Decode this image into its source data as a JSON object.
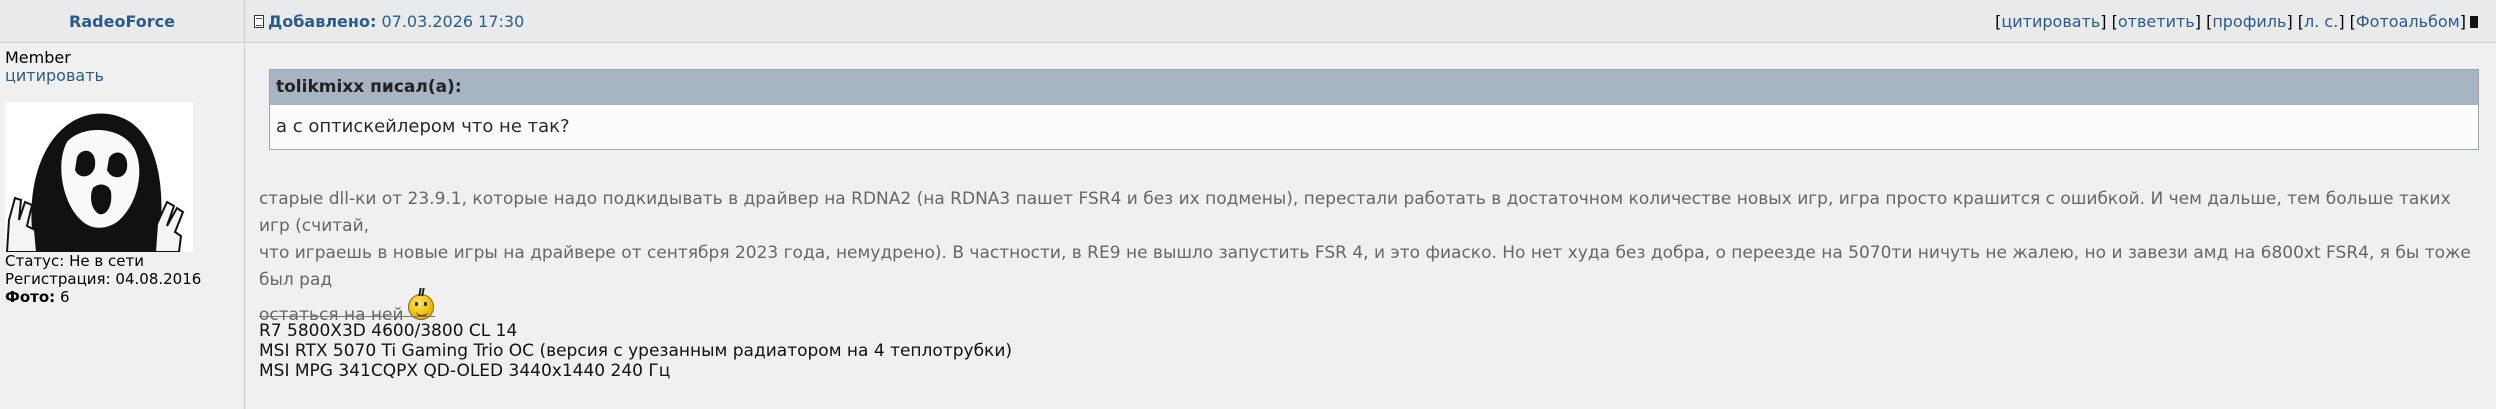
{
  "header": {
    "author": "RadeoForce",
    "added_label": "Добавлено:",
    "added_date": "07.03.2026 17:30",
    "actions": [
      "цитировать",
      "ответить",
      "профиль",
      "л. с.",
      "Фотоальбом"
    ]
  },
  "sidebar": {
    "rank": "Member",
    "quote_link": "цитировать",
    "avatar_icon": "ghostface-peace-sign-avatar",
    "status_label": "Статус:",
    "status_value": "Не в сети",
    "reg_label": "Регистрация:",
    "reg_value": "04.08.2016",
    "photo_label": "Фото:",
    "photo_value": "6"
  },
  "quote": {
    "author": "tolikmixx писал(а):",
    "text": "а с оптискейлером что не так?"
  },
  "message": {
    "line1": "старые dll-ки от 23.9.1, которые надо подкидывать в драйвер на RDNA2 (на RDNA3 пашет FSR4 и без их подмены), перестали работать в достаточном количестве новых игр, игра просто крашится с ошибкой. И чем дальше, тем больше таких игр (считай,",
    "line2": "что играешь в новые игры на драйвере от сентября 2023 года, немудрено). В частности, в RE9 не вышло запустить FSR 4, и это фиаско. Но нет худа без добра, о переезде на 5070ти ничуть не жалею, но и завези амд на 6800xt FSR4, я бы тоже был рад",
    "line3": "остаться на ней",
    "smile_icon": "smile-icon"
  },
  "signature": {
    "lines": [
      "R7 5800X3D 4600/3800 CL 14",
      "MSI RTX 5070 Ti Gaming Trio OC (версия с урезанным радиатором на 4 теплотрубки)",
      "MSI MPG 341CQPX QD-OLED 3440x1440 240 Гц"
    ]
  },
  "colors": {
    "background": "#f0f0f0",
    "link": "#2c5b8a",
    "quote_header": "#a7b4c2"
  }
}
